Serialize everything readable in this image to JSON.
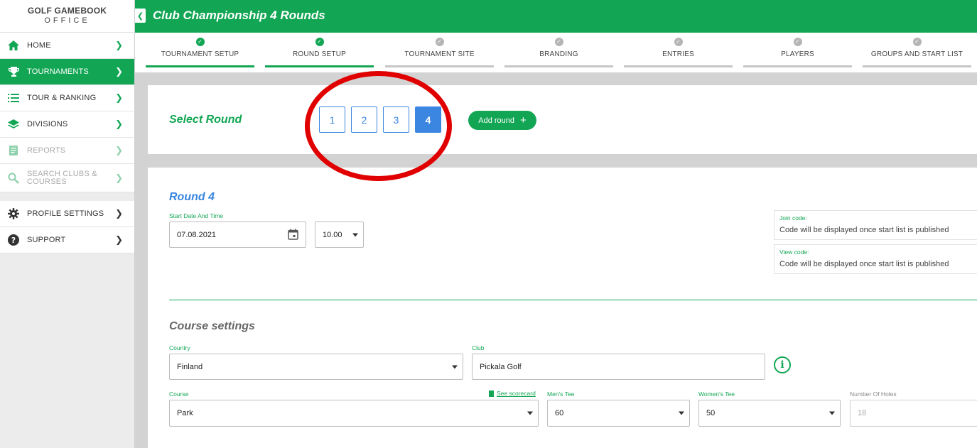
{
  "brand": {
    "logo_top": "GOLF GAMEBOOK",
    "logo_sub": "OFFICE",
    "accent": "#12a654",
    "blue": "#3a86e0",
    "highlight": "#e00000"
  },
  "sidebar": {
    "items": [
      {
        "label": "HOME",
        "icon": "home-icon"
      },
      {
        "label": "TOURNAMENTS",
        "icon": "trophy-icon",
        "active": true
      },
      {
        "label": "TOUR & RANKING",
        "icon": "list-icon"
      },
      {
        "label": "DIVISIONS",
        "icon": "layers-icon"
      },
      {
        "label": "REPORTS",
        "icon": "report-icon",
        "disabled": true
      },
      {
        "label": "SEARCH CLUBS &",
        "label2": "COURSES",
        "icon": "search-icon",
        "disabled": true
      },
      {
        "label": "PROFILE SETTINGS",
        "icon": "gear-icon"
      },
      {
        "label": "SUPPORT",
        "icon": "help-icon"
      }
    ]
  },
  "header": {
    "title": "Club Championship 4 Rounds"
  },
  "steps": [
    {
      "label": "TOURNAMENT SETUP",
      "done": true
    },
    {
      "label": "ROUND SETUP",
      "done": true
    },
    {
      "label": "TOURNAMENT SITE",
      "done": false
    },
    {
      "label": "BRANDING",
      "done": false
    },
    {
      "label": "ENTRIES",
      "done": false
    },
    {
      "label": "PLAYERS",
      "done": false
    },
    {
      "label": "GROUPS AND START LIST",
      "done": false
    }
  ],
  "round_select": {
    "title": "Select Round",
    "rounds": [
      "1",
      "2",
      "3",
      "4"
    ],
    "selected": "4",
    "add_label": "Add round",
    "add_symbol": "+"
  },
  "round": {
    "title": "Round 4",
    "start_label": "Start Date And Time",
    "date": "07.08.2021",
    "time": "10.00",
    "join_label": "Join code:",
    "join_value": "Code will be displayed once start list is published",
    "view_label": "View code:",
    "view_value": "Code will be displayed once start list is published"
  },
  "course_settings": {
    "title": "Course settings",
    "country_label": "Country",
    "country": "Finland",
    "club_label": "Club",
    "club": "Pickala Golf",
    "info_symbol": "i",
    "course_label": "Course",
    "scorecard_label": "See scorecard",
    "course": "Park",
    "mens_tee_label": "Men's Tee",
    "mens_tee": "60",
    "womens_tee_label": "Women's Tee",
    "womens_tee": "50",
    "holes_label": "Number Of Holes",
    "holes": "18"
  }
}
